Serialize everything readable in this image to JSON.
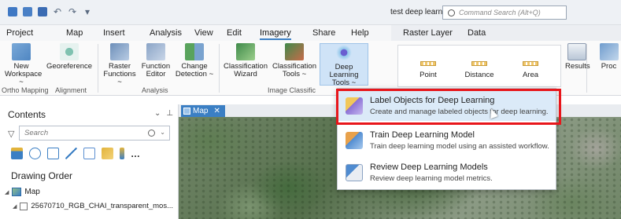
{
  "titlebar": {
    "document_title": "test deep learning",
    "command_search_placeholder": "Command Search (Alt+Q)"
  },
  "tabs": [
    "Project",
    "Map",
    "Insert",
    "Analysis",
    "View",
    "Edit",
    "Imagery",
    "Share",
    "Help"
  ],
  "active_tab": "Imagery",
  "context_tabs": [
    "Raster Layer",
    "Data"
  ],
  "ribbon": {
    "new_workspace": [
      "New",
      "Workspace ~"
    ],
    "georeference": "Georeference",
    "raster_functions": [
      "Raster",
      "Functions ~"
    ],
    "function_editor": [
      "Function",
      "Editor"
    ],
    "change_detection": [
      "Change",
      "Detection ~"
    ],
    "classification_wizard": [
      "Classification",
      "Wizard"
    ],
    "classification_tools": [
      "Classification",
      "Tools ~"
    ],
    "deep_learning_tools": [
      "Deep Learning",
      "Tools ~"
    ],
    "measure": [
      "Point",
      "Distance",
      "Area"
    ],
    "results": "Results",
    "process": "Proc",
    "groups": {
      "ortho_mapping": "Ortho Mapping",
      "alignment": "Alignment",
      "analysis": "Analysis",
      "image_classification": "Image Classific"
    }
  },
  "contents": {
    "title": "Contents",
    "search_placeholder": "Search",
    "drawing_order": "Drawing Order",
    "map_node": "Map",
    "layer_name": "25670710_RGB_CHAI_transparent_mos..."
  },
  "map_tab": "Map",
  "menu": {
    "items": [
      {
        "title": "Label Objects for Deep Learning",
        "desc": "Create and manage labeled objects for deep learning."
      },
      {
        "title": "Train Deep Learning Model",
        "desc": "Train deep learning model using an assisted workflow."
      },
      {
        "title": "Review Deep Learning Models",
        "desc": "Review deep learning model metrics."
      }
    ]
  },
  "colors": {
    "accent": "#3b7fc4",
    "highlight_box": "#e8161b",
    "menu_hover": "#dbeaf8"
  }
}
